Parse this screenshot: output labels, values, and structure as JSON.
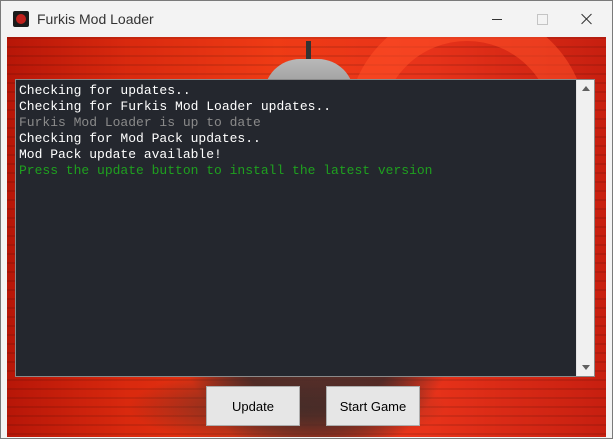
{
  "window": {
    "title": "Furkis Mod Loader",
    "icon": "app-logo-icon"
  },
  "caption_buttons": {
    "minimize_icon": "minimize-icon",
    "maximize_icon": "maximize-icon",
    "close_icon": "close-icon"
  },
  "console": {
    "lines": [
      {
        "text": "Checking for updates..",
        "color": "#ffffff"
      },
      {
        "text": "Checking for Furkis Mod Loader updates..",
        "color": "#ffffff"
      },
      {
        "text": "Furkis Mod Loader is up to date",
        "color": "#8a8a8a"
      },
      {
        "text": "Checking for Mod Pack updates..",
        "color": "#ffffff"
      },
      {
        "text": "Mod Pack update available!",
        "color": "#ffffff"
      },
      {
        "text": "Press the update button to install the latest version",
        "color": "#1fa01f"
      }
    ]
  },
  "buttons": {
    "update_label": "Update",
    "start_label": "Start Game"
  },
  "colors": {
    "console_bg": "#24272e",
    "accent_red": "#e8331a"
  }
}
